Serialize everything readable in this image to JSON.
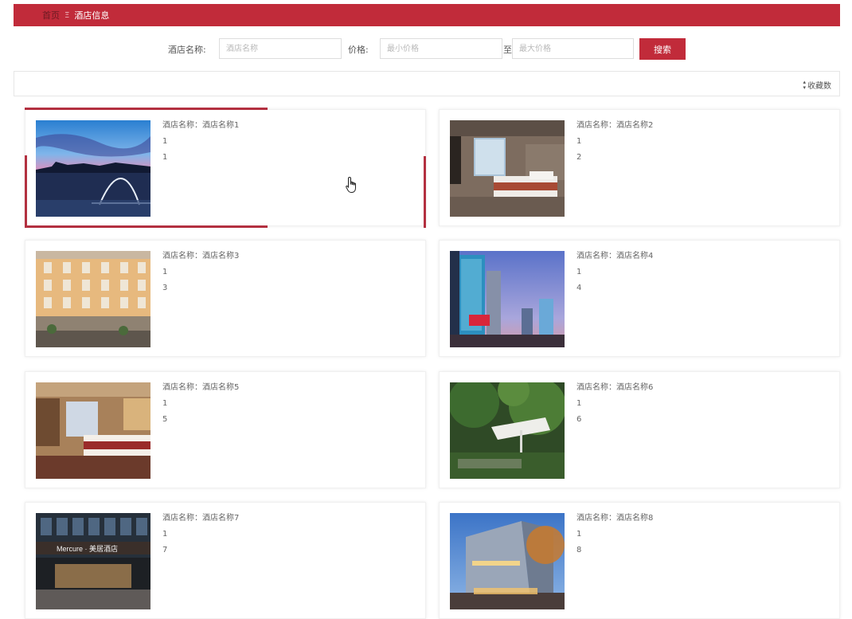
{
  "breadcrumb": {
    "home": "首页",
    "separator": "Ξ",
    "current": "酒店信息"
  },
  "search": {
    "name_label": "酒店名称:",
    "name_placeholder": "酒店名称",
    "price_label": "价格:",
    "min_placeholder": "最小价格",
    "range_sep": "至",
    "max_placeholder": "最大价格",
    "button_label": "搜索"
  },
  "sort": {
    "label": "收藏数",
    "icon": "sort-icon"
  },
  "colors": {
    "brand": "#c12b3a",
    "hover_border": "#b33040"
  },
  "hotels": [
    {
      "name_line": "酒店名称：酒店名称1",
      "line2": "1",
      "line3": "1"
    },
    {
      "name_line": "酒店名称：酒店名称2",
      "line2": "1",
      "line3": "2"
    },
    {
      "name_line": "酒店名称：酒店名称3",
      "line2": "1",
      "line3": "3"
    },
    {
      "name_line": "酒店名称：酒店名称4",
      "line2": "1",
      "line3": "4"
    },
    {
      "name_line": "酒店名称：酒店名称5",
      "line2": "1",
      "line3": "5"
    },
    {
      "name_line": "酒店名称：酒店名称6",
      "line2": "1",
      "line3": "6"
    },
    {
      "name_line": "酒店名称：酒店名称7",
      "line2": "1",
      "line3": "7"
    },
    {
      "name_line": "酒店名称：酒店名称8",
      "line2": "1",
      "line3": "8"
    }
  ],
  "photo7_sign": "Mercure · 美居酒店"
}
